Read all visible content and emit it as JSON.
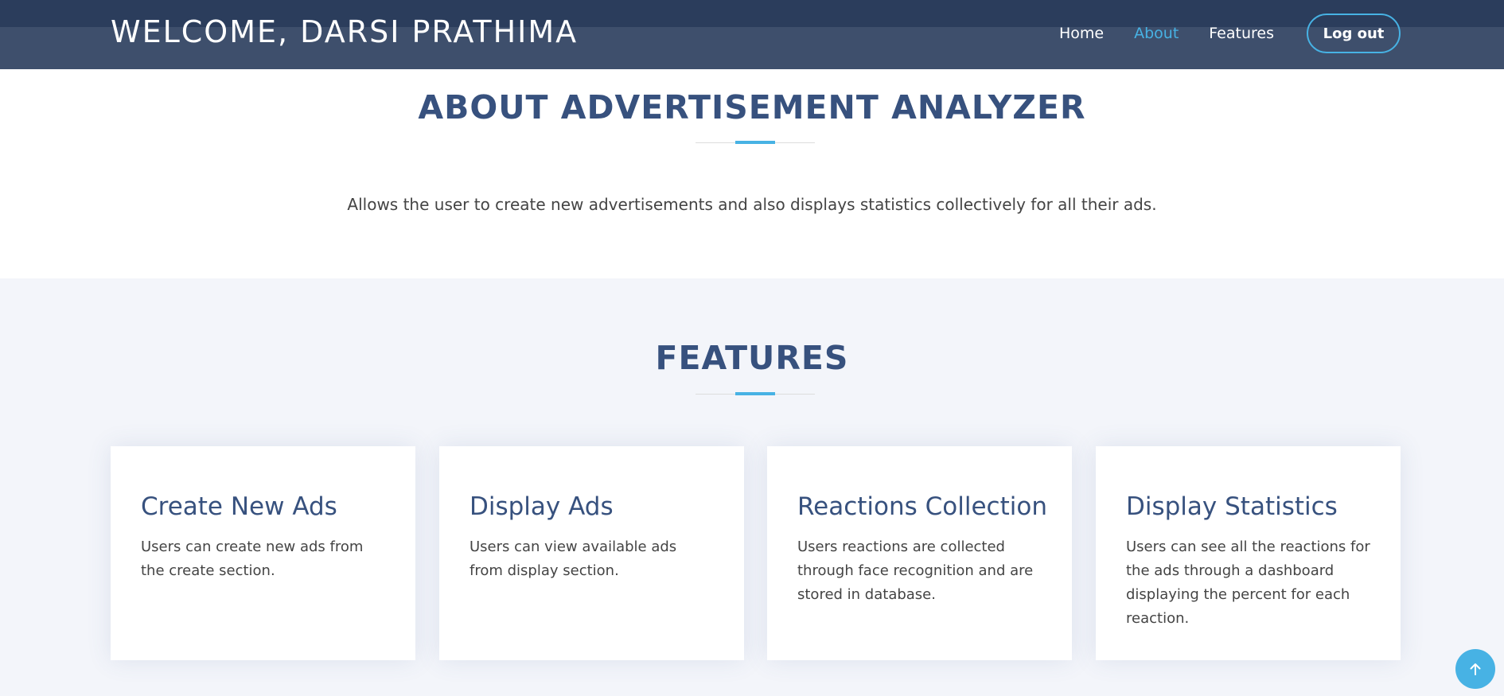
{
  "header": {
    "brand": "WELCOME, DARSI PRATHIMA",
    "nav": {
      "home": "Home",
      "about": "About",
      "features": "Features",
      "logout": "Log out"
    }
  },
  "about": {
    "title": "ABOUT ADVERTISEMENT ANALYZER",
    "text": "Allows the user to create new advertisements and also displays statistics collectively for all their ads."
  },
  "features": {
    "title": "FEATURES",
    "cards": [
      {
        "title": "Create New Ads",
        "text": "Users can create new ads from the create section."
      },
      {
        "title": "Display Ads",
        "text": "Users can view available ads from display section."
      },
      {
        "title": "Reactions Collection",
        "text": "Users reactions are collected through face recognition and are stored in database."
      },
      {
        "title": "Display Statistics",
        "text": "Users can see all the reactions for the ads through a dashboard displaying the percent for each reaction."
      }
    ]
  },
  "colors": {
    "header_bg": "#3e4f6c",
    "accent": "#47b2e4",
    "heading": "#37517e",
    "features_bg": "#f3f5fa"
  },
  "icons": {
    "back_to_top": "arrow-up-icon"
  }
}
